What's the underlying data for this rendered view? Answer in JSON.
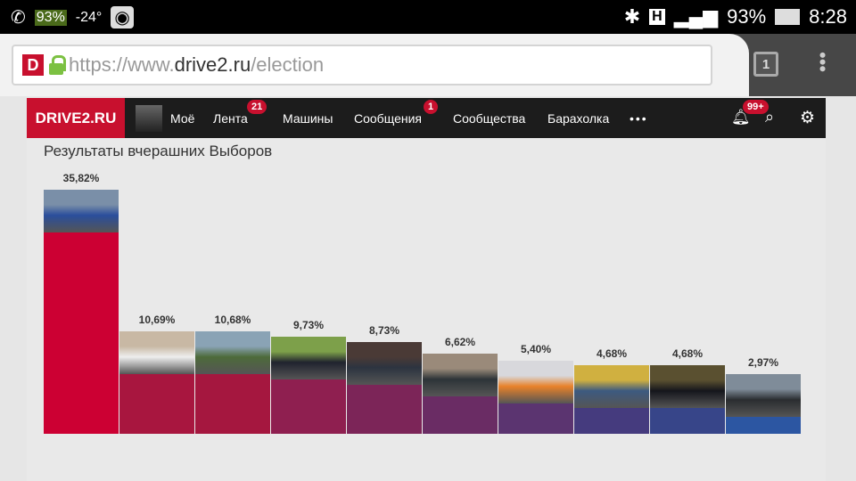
{
  "status_bar": {
    "battery_left": "93%",
    "temperature": "-24°",
    "network": "H",
    "battery": "93%",
    "time": "8:28"
  },
  "browser": {
    "url_scheme": "https://www.",
    "url_domain": "drive2.ru",
    "url_path": "/election",
    "tab_count": "1",
    "site_icon": "D"
  },
  "nav": {
    "logo": "DRIVE2.RU",
    "items": [
      {
        "label": "Моё"
      },
      {
        "label": "Лента",
        "badge": "21"
      },
      {
        "label": "Машины"
      },
      {
        "label": "Сообщения",
        "badge": "1"
      },
      {
        "label": "Сообщества"
      },
      {
        "label": "Барахолка"
      },
      {
        "label": "•••"
      }
    ],
    "notifications_badge": "99+"
  },
  "page": {
    "title": "Результаты вчерашних Выборов"
  },
  "chart_data": {
    "type": "bar",
    "title": "Результаты вчерашних Выборов",
    "labels": [
      "35,82%",
      "10,69%",
      "10,68%",
      "9,73%",
      "8,73%",
      "6,62%",
      "5,40%",
      "4,68%",
      "4,68%",
      "2,97%"
    ],
    "values": [
      35.82,
      10.69,
      10.68,
      9.73,
      8.73,
      6.62,
      5.4,
      4.68,
      4.68,
      2.97
    ],
    "colors": [
      "#cc0033",
      "#a8163f",
      "#a5173f",
      "#8f1f50",
      "#7c2558",
      "#6a2c64",
      "#5b3470",
      "#453b7e",
      "#374589",
      "#2c56a2"
    ],
    "image_colors": [
      [
        "#7a8fa8",
        "#2a4e9c"
      ],
      [
        "#c8b8a4",
        "#eeeeee"
      ],
      [
        "#8aa3b5",
        "#4d6b3a"
      ],
      [
        "#7da04a",
        "#20232e"
      ],
      [
        "#4a3a36",
        "#2c3440"
      ],
      [
        "#9a8a7a",
        "#2d3438"
      ],
      [
        "#d8d8dc",
        "#e8822a"
      ],
      [
        "#d0b040",
        "#3d5a80"
      ],
      [
        "#5a5030",
        "#15161c"
      ],
      [
        "#7f8c99",
        "#2a2d30"
      ]
    ]
  }
}
